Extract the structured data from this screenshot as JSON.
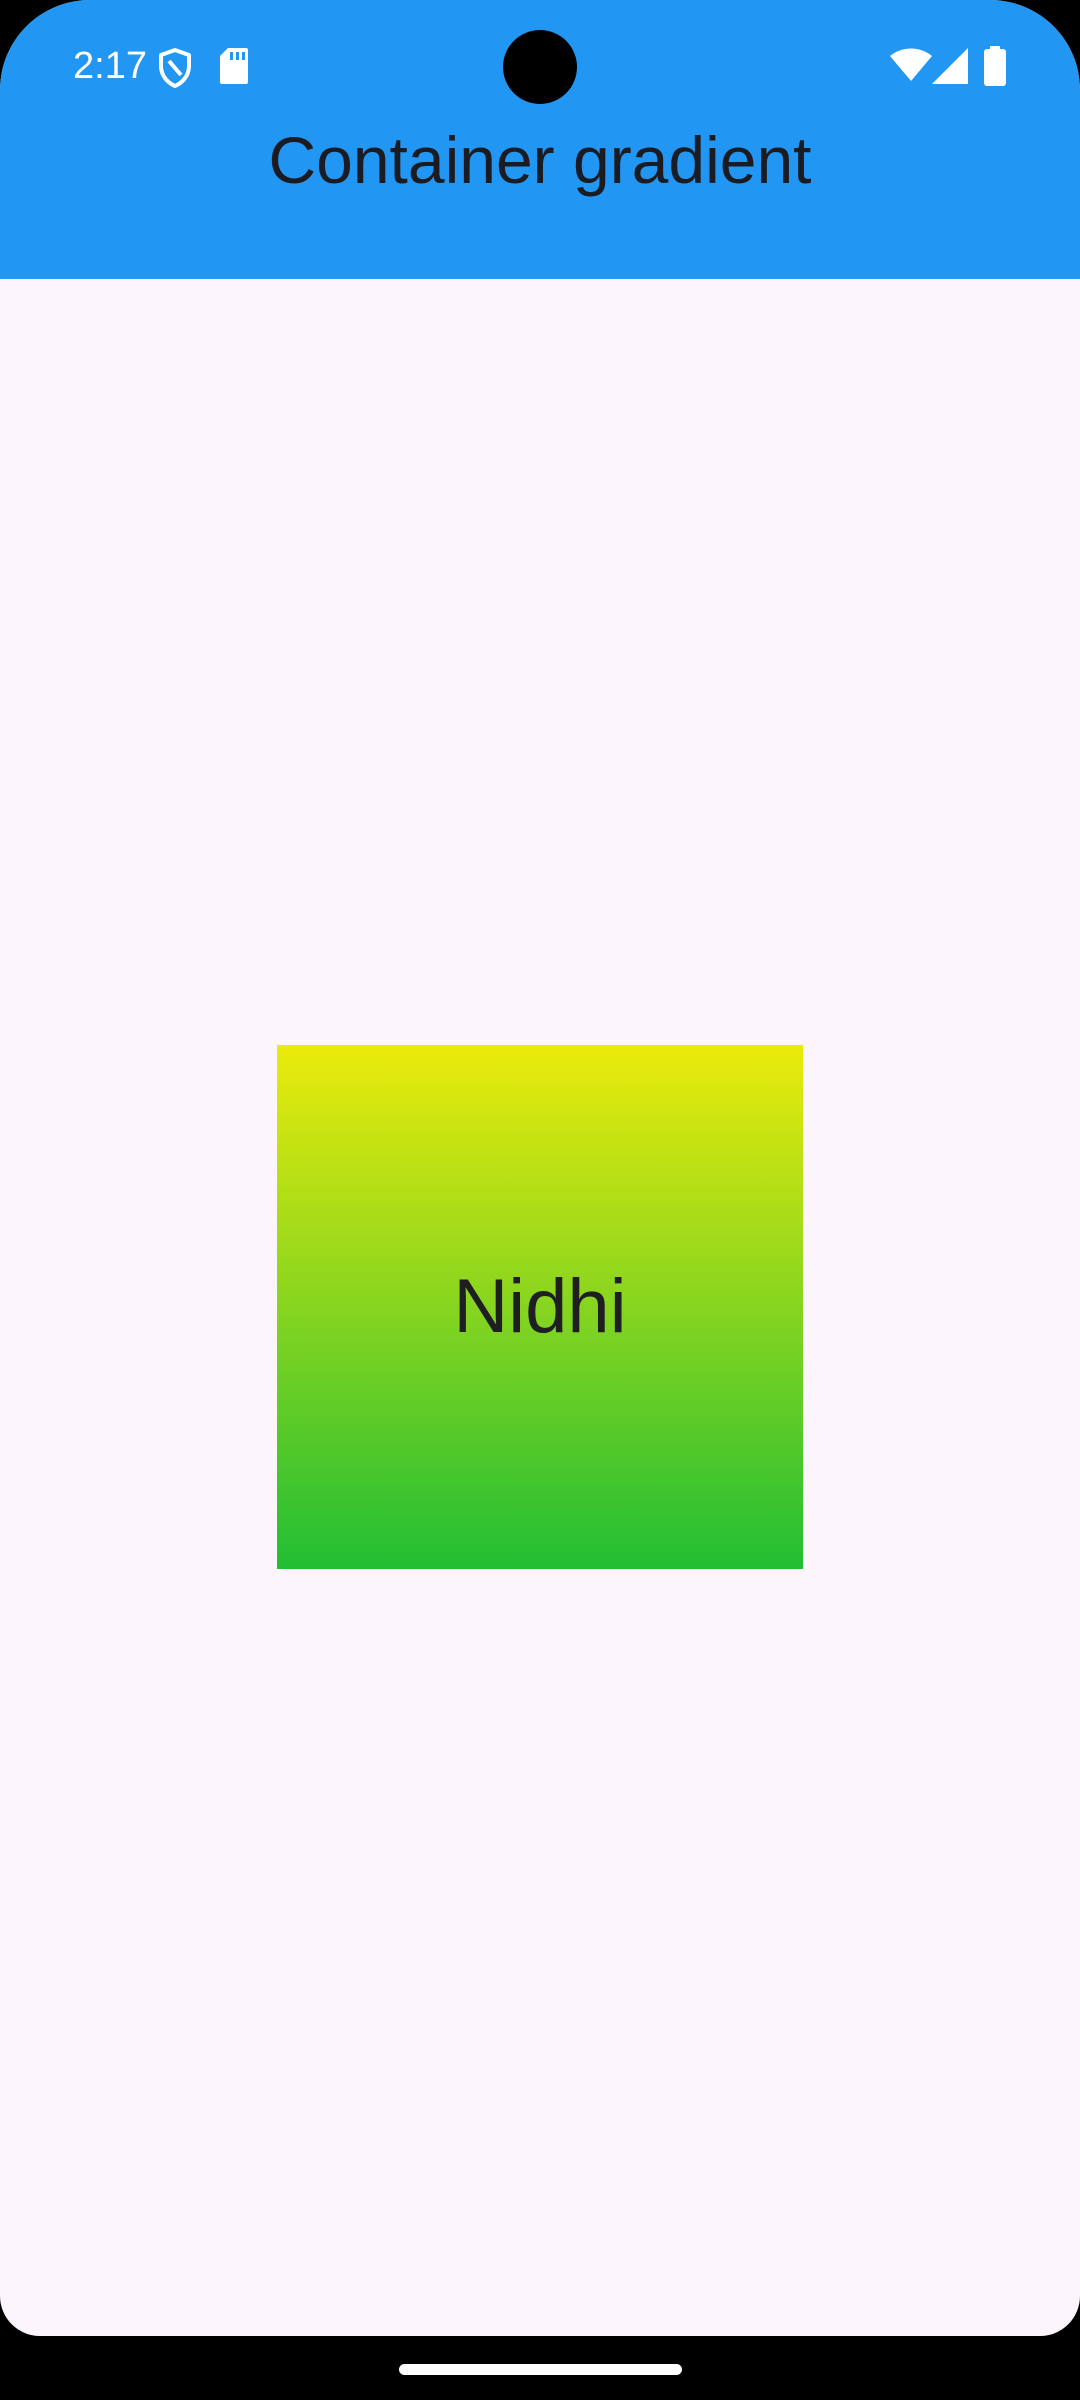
{
  "status_bar": {
    "time": "2:17",
    "icons": [
      "shield-icon",
      "sd-card-icon",
      "wifi-icon",
      "cell-signal-icon",
      "battery-icon"
    ]
  },
  "app_bar": {
    "title": "Container gradient",
    "background_color": "#2196F3",
    "title_color": "#1B1C22"
  },
  "content": {
    "background_color": "#FCF5FC",
    "gradient_box": {
      "label": "Nidhi",
      "gradient_start_color": "#EBEB0B",
      "gradient_end_color": "#22BE34",
      "direction": "top-to-bottom"
    }
  },
  "nav": {
    "gesture": "home-handle"
  }
}
